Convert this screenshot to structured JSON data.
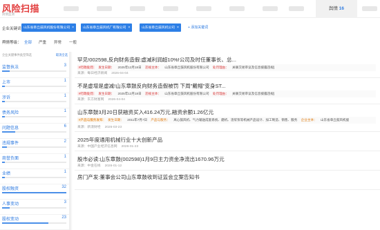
{
  "header": {
    "logo": "风险扫描",
    "logo_sub": "舆情监测",
    "tab_label": "舆情",
    "tab_count": "16"
  },
  "filters": {
    "keyword_label": "企业关键词：",
    "keywords": [
      "山东省章丘鼓风机股份有限公司",
      "山东省章丘鼓风机厂有限公司",
      "山东省章丘鼓风机公司"
    ],
    "add_keyword": "+ 添加关键词",
    "sentiment_label": "舆情等级：",
    "sentiment_options": [
      "全部",
      "严重",
      "异常",
      "一般"
    ],
    "sentiment_active": "全部"
  },
  "sidebar": {
    "head_label": "企业关键事件类型筛选",
    "cancel": "取消全选",
    "items": [
      {
        "name": "监督执法",
        "count": "3",
        "pct": 0.12
      },
      {
        "name": "上市",
        "count": "1",
        "pct": 0.04
      },
      {
        "name": "涉诉",
        "count": "1",
        "pct": 0.04
      },
      {
        "name": "债务风险",
        "count": "1",
        "pct": 0.04
      },
      {
        "name": "问题信息",
        "count": "6",
        "pct": 0.2
      },
      {
        "name": "违规事件",
        "count": "2",
        "pct": 0.08
      },
      {
        "name": "商誉负面",
        "count": "1",
        "pct": 0.04
      },
      {
        "name": "业绩",
        "count": "1",
        "pct": 0.04
      },
      {
        "name": "股权融资",
        "count": "32",
        "pct": 1.0
      },
      {
        "name": "人事变动",
        "count": "3",
        "pct": 0.12
      },
      {
        "name": "股权变动",
        "count": "23",
        "pct": 0.72
      }
    ]
  },
  "news": [
    {
      "title": "罕见!002598,反向财务造假:虚减利润超10%!公司及时任董事长、总...",
      "tags": [
        {
          "text": "#行政处罚",
          "cls": "red"
        },
        {
          "text": "发生日期：",
          "cls": "red"
        },
        {
          "text": "2025年12月18日",
          "cls": "gray"
        },
        {
          "text": "违规主体：",
          "cls": "red"
        },
        {
          "text": "山东省章丘鼓风机股份有限公司",
          "cls": "gray"
        },
        {
          "text": "处罚理由：",
          "cls": "red"
        },
        {
          "text": "关联交易审议及信息披露违规]",
          "cls": "gray"
        }
      ],
      "source": "来源：每日经济新闻",
      "date": "2026-04-04"
    },
    {
      "title": "不是虚增是虚减!山东章鼓反向财务造假被罚 下周\"戴帽\"变身ST...",
      "tags": [
        {
          "text": "#行政处罚",
          "cls": "red"
        },
        {
          "text": "发生日期：",
          "cls": "red"
        },
        {
          "text": "2025年12月18日",
          "cls": "gray"
        },
        {
          "text": "违规主体：",
          "cls": "red"
        },
        {
          "text": "山东省章丘鼓风机股份有限公司",
          "cls": "gray"
        },
        {
          "text": "处罚理由：",
          "cls": "red"
        },
        {
          "text": "关联交易审议及信息披露违规]",
          "cls": "gray"
        }
      ],
      "source": "来源：东方财富网",
      "date": "2026-04-04"
    },
    {
      "title": "山东章鼓3月20日获融资买入416.24万元,融资余额1.26亿元",
      "tags": [
        {
          "text": "#产品与服务发布",
          "cls": "orange"
        },
        {
          "text": "发生日期：",
          "cls": "orange"
        },
        {
          "text": "2011年7月7日",
          "cls": "gray"
        },
        {
          "text": "产品与服务：",
          "cls": "orange"
        },
        {
          "text": "离心鼓风机、气力输送成套系统、磨机、渣浆泵等机械产品设计、加工制造、销售、服务",
          "cls": "gray"
        },
        {
          "text": "企业主体：",
          "cls": "orange"
        },
        {
          "text": "山东省章丘鼓风机股",
          "cls": "gray"
        }
      ],
      "source": "来源：新浪财经",
      "date": "2026-03-23"
    },
    {
      "title": "2025年度通用机械行业十大创新产品",
      "tags": [],
      "source": "来源：中国产业经济信息网",
      "date": "2026-01-23"
    },
    {
      "title": "股市必读:山东章鼓(002598)1月9日主力资金净流出1670.96万元",
      "tags": [],
      "source": "来源：中金在线",
      "date": "2026-01-12"
    },
    {
      "title": "房门产发:董事会公司山东章鼓收到证监会立案告知书",
      "tags": [],
      "source": "",
      "date": ""
    }
  ],
  "colors": {
    "accent": "#2f7be0",
    "logo": "#e23b3b",
    "danger": "#d83a3a",
    "warning": "#e07d12"
  }
}
